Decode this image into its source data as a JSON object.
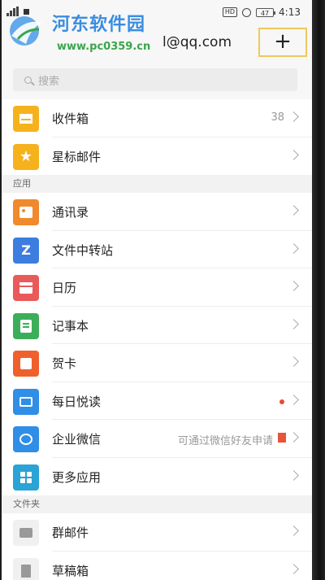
{
  "statusbar": {
    "signal": "4G",
    "badges": {
      "hd": "HD"
    },
    "battery": "47",
    "time": "4:13"
  },
  "header": {
    "account_visible": "l@qq.com",
    "add_label": "+"
  },
  "watermark": {
    "title": "河东软件园",
    "url": "www.pc0359.cn"
  },
  "search": {
    "placeholder": "搜索"
  },
  "mailboxes": [
    {
      "label": "收件箱",
      "count": "38",
      "icon": "envelope-icon",
      "color": "#f5b21c"
    },
    {
      "label": "星标邮件",
      "icon": "star-icon",
      "color": "#f5b21c"
    }
  ],
  "sections": {
    "apps": "应用",
    "folders": "文件夹"
  },
  "apps": [
    {
      "label": "通讯录",
      "icon": "contacts-icon",
      "color": "#f08a2c"
    },
    {
      "label": "文件中转站",
      "icon": "file-transfer-icon",
      "color": "#3d7de0"
    },
    {
      "label": "日历",
      "icon": "calendar-icon",
      "color": "#ea5a5a"
    },
    {
      "label": "记事本",
      "icon": "notepad-icon",
      "color": "#3cae5a"
    },
    {
      "label": "贺卡",
      "icon": "greeting-card-icon",
      "color": "#f0602c"
    },
    {
      "label": "每日悦读",
      "icon": "daily-reading-icon",
      "color": "#2f8ee6"
    },
    {
      "label": "企业微信",
      "hint": "可通过微信好友申请",
      "icon": "wework-icon",
      "color": "#2f8ee6"
    },
    {
      "label": "更多应用",
      "icon": "more-apps-icon",
      "color": "#2aa3d6"
    }
  ],
  "folders": [
    {
      "label": "群邮件",
      "icon": "group-mail-icon"
    },
    {
      "label": "草稿箱",
      "icon": "drafts-icon"
    }
  ]
}
